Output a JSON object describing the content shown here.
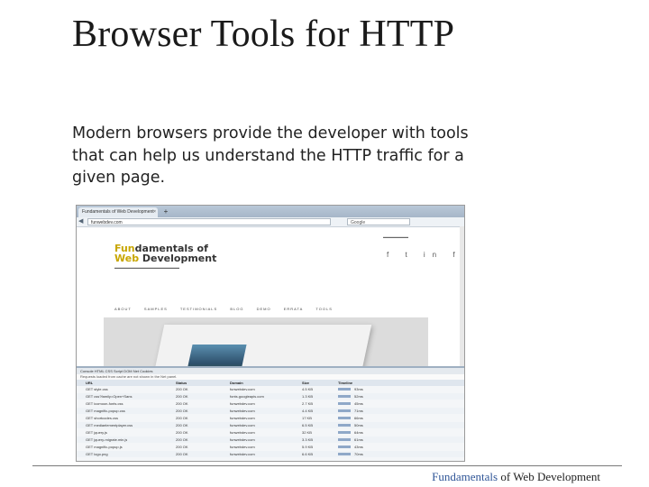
{
  "slide": {
    "title": "Browser Tools for HTTP",
    "body": "Modern browsers provide the developer with tools that can help us understand the HTTP traffic for a given page.",
    "footer_highlight": "Fundamentals",
    "footer_rest": " of Web Development"
  },
  "screenshot": {
    "tab_title": "Fundamentals of Web Development",
    "tab_close": "×",
    "new_tab": "+",
    "url": "funwebdev.com",
    "search_placeholder": "Google",
    "site": {
      "logo_highlight_1": "Fun",
      "logo_rest_1": "damentals of",
      "logo_highlight_2": "Web",
      "logo_rest_2": " Development",
      "social": "f t in fr",
      "nav": [
        "ABOUT",
        "SAMPLES",
        "TESTIMONIALS",
        "BLOG",
        "DEMO",
        "ERRATA",
        "TOOLS"
      ]
    },
    "devtools": {
      "toolbar": "Console  HTML  CSS  Script  DOM  Net  Cookies",
      "notice": "Requests loaded from cache are not shown in the Net panel. ",
      "columns": [
        "URL",
        "Status",
        "Domain",
        "Size",
        "Timeline"
      ],
      "rows": [
        [
          "GET style.css",
          "200 OK",
          "funwebdev.com",
          "4.5 KB",
          "93ms"
        ],
        [
          "GET css?family=Open+Sans",
          "200 OK",
          "fonts.googleapis.com",
          "1.3 KB",
          "52ms"
        ],
        [
          "GET icomoon-fonts.css",
          "200 OK",
          "funwebdev.com",
          "2.7 KB",
          "45ms"
        ],
        [
          "GET magnific-popup.css",
          "200 OK",
          "funwebdev.com",
          "4.4 KB",
          "71ms"
        ],
        [
          "GET shortcodes.css",
          "200 OK",
          "funwebdev.com",
          "17 KB",
          "66ms"
        ],
        [
          "GET mediaelementplayer.css",
          "200 OK",
          "funwebdev.com",
          "6.5 KB",
          "50ms"
        ],
        [
          "GET jquery.js",
          "200 OK",
          "funwebdev.com",
          "32 KB",
          "64ms"
        ],
        [
          "GET jquery-migrate.min.js",
          "200 OK",
          "funwebdev.com",
          "3.3 KB",
          "61ms"
        ],
        [
          "GET magnific-popup.js",
          "200 OK",
          "funwebdev.com",
          "5.9 KB",
          "43ms"
        ],
        [
          "GET logo.png",
          "200 OK",
          "funwebdev.com",
          "6.6 KB",
          "70ms"
        ]
      ]
    }
  },
  "colors": {
    "title": "#1a1a1a",
    "footer_highlight": "#2f5597",
    "logo_highlight": "#c8a600"
  }
}
